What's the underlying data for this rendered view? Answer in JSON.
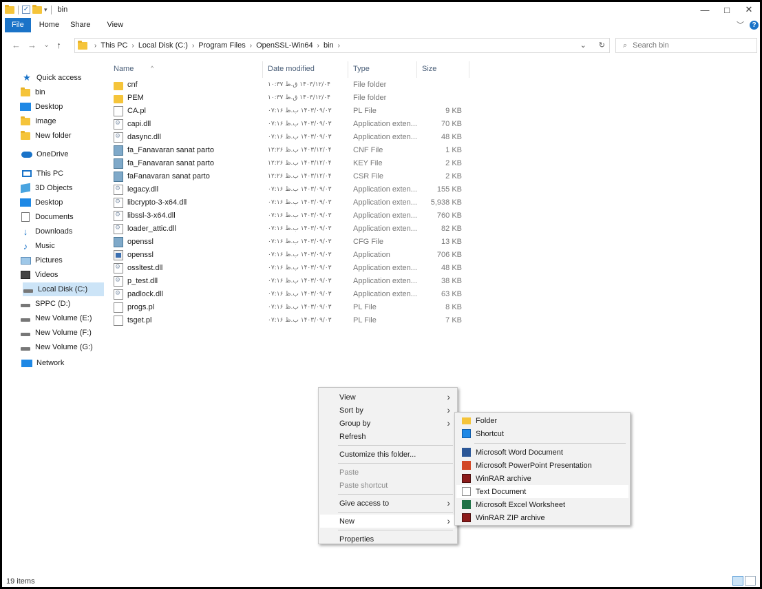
{
  "window": {
    "title": "bin",
    "minimize": "—",
    "maximize": "□",
    "close": "✕"
  },
  "ribbon": {
    "tabs": [
      "File",
      "Home",
      "Share",
      "View"
    ],
    "expand_icon": "﹀",
    "help_icon": "?"
  },
  "nav_glyphs": {
    "back": "←",
    "forward": "→",
    "recent": "⌄",
    "up": "↑",
    "dropdown": "⌄",
    "refresh": "↻",
    "search": "⌕"
  },
  "address": {
    "crumbs": [
      "This PC",
      "Local Disk (C:)",
      "Program Files",
      "OpenSSL-Win64",
      "bin"
    ],
    "separator": "›"
  },
  "search": {
    "placeholder": "Search bin"
  },
  "sidebar": {
    "quick_access": "Quick access",
    "quick_items": [
      "bin",
      "Desktop",
      "Image",
      "New folder"
    ],
    "onedrive": "OneDrive",
    "this_pc": "This PC",
    "pc_items": [
      "3D Objects",
      "Desktop",
      "Documents",
      "Downloads",
      "Music",
      "Pictures",
      "Videos",
      "Local Disk (C:)",
      "SPPC (D:)",
      "New Volume (E:)",
      "New Volume (F:)",
      "New Volume (G:)"
    ],
    "network": "Network"
  },
  "columns": {
    "name": "Name",
    "date": "Date modified",
    "type": "Type",
    "size": "Size",
    "sort_caret": "^"
  },
  "files": [
    {
      "name": "cnf",
      "date": "۱۴۰۳/۱۲/۰۴ ق.ظ ۱۰:۳۷",
      "type": "File folder",
      "size": "",
      "icon": "folder"
    },
    {
      "name": "PEM",
      "date": "۱۴۰۳/۱۲/۰۴ ق.ظ ۱۰:۳۷",
      "type": "File folder",
      "size": "",
      "icon": "folder"
    },
    {
      "name": "CA.pl",
      "date": "۱۴۰۳/۰۹/۰۳ ب.ظ ۰۷:۱۶",
      "type": "PL File",
      "size": "9 KB",
      "icon": "file"
    },
    {
      "name": "capi.dll",
      "date": "۱۴۰۳/۰۹/۰۳ ب.ظ ۰۷:۱۶",
      "type": "Application exten...",
      "size": "70 KB",
      "icon": "dll"
    },
    {
      "name": "dasync.dll",
      "date": "۱۴۰۳/۰۹/۰۳ ب.ظ ۰۷:۱۶",
      "type": "Application exten...",
      "size": "48 KB",
      "icon": "dll"
    },
    {
      "name": "fa_Fanavaran sanat parto",
      "date": "۱۴۰۳/۱۲/۰۴ ب.ظ ۱۲:۲۶",
      "type": "CNF File",
      "size": "1 KB",
      "icon": "cert"
    },
    {
      "name": "fa_Fanavaran sanat parto",
      "date": "۱۴۰۳/۱۲/۰۴ ب.ظ ۱۲:۲۶",
      "type": "KEY File",
      "size": "2 KB",
      "icon": "cert"
    },
    {
      "name": "faFanavaran sanat parto",
      "date": "۱۴۰۳/۱۲/۰۴ ب.ظ ۱۲:۲۶",
      "type": "CSR File",
      "size": "2 KB",
      "icon": "cert"
    },
    {
      "name": "legacy.dll",
      "date": "۱۴۰۳/۰۹/۰۳ ب.ظ ۰۷:۱۶",
      "type": "Application exten...",
      "size": "155 KB",
      "icon": "dll"
    },
    {
      "name": "libcrypto-3-x64.dll",
      "date": "۱۴۰۳/۰۹/۰۳ ب.ظ ۰۷:۱۶",
      "type": "Application exten...",
      "size": "5,938 KB",
      "icon": "dll"
    },
    {
      "name": "libssl-3-x64.dll",
      "date": "۱۴۰۳/۰۹/۰۳ ب.ظ ۰۷:۱۶",
      "type": "Application exten...",
      "size": "760 KB",
      "icon": "dll"
    },
    {
      "name": "loader_attic.dll",
      "date": "۱۴۰۳/۰۹/۰۳ ب.ظ ۰۷:۱۶",
      "type": "Application exten...",
      "size": "82 KB",
      "icon": "dll"
    },
    {
      "name": "openssl",
      "date": "۱۴۰۳/۰۹/۰۳ ب.ظ ۰۷:۱۶",
      "type": "CFG File",
      "size": "13 KB",
      "icon": "cfg"
    },
    {
      "name": "openssl",
      "date": "۱۴۰۳/۰۹/۰۳ ب.ظ ۰۷:۱۶",
      "type": "Application",
      "size": "706 KB",
      "icon": "app"
    },
    {
      "name": "ossltest.dll",
      "date": "۱۴۰۳/۰۹/۰۳ ب.ظ ۰۷:۱۶",
      "type": "Application exten...",
      "size": "48 KB",
      "icon": "dll"
    },
    {
      "name": "p_test.dll",
      "date": "۱۴۰۳/۰۹/۰۳ ب.ظ ۰۷:۱۶",
      "type": "Application exten...",
      "size": "38 KB",
      "icon": "dll"
    },
    {
      "name": "padlock.dll",
      "date": "۱۴۰۳/۰۹/۰۳ ب.ظ ۰۷:۱۶",
      "type": "Application exten...",
      "size": "63 KB",
      "icon": "dll"
    },
    {
      "name": "progs.pl",
      "date": "۱۴۰۳/۰۹/۰۳ ب.ظ ۰۷:۱۶",
      "type": "PL File",
      "size": "8 KB",
      "icon": "file"
    },
    {
      "name": "tsget.pl",
      "date": "۱۴۰۳/۰۹/۰۳ ب.ظ ۰۷:۱۶",
      "type": "PL File",
      "size": "7 KB",
      "icon": "file"
    }
  ],
  "context_menu": {
    "submenu_arrow": "›",
    "items": [
      {
        "label": "View",
        "submenu": true,
        "disabled": false
      },
      {
        "label": "Sort by",
        "submenu": true,
        "disabled": false
      },
      {
        "label": "Group by",
        "submenu": true,
        "disabled": false
      },
      {
        "label": "Refresh",
        "submenu": false,
        "disabled": false
      },
      {
        "sep": true
      },
      {
        "label": "Customize this folder...",
        "submenu": false,
        "disabled": false
      },
      {
        "sep": true
      },
      {
        "label": "Paste",
        "submenu": false,
        "disabled": true
      },
      {
        "label": "Paste shortcut",
        "submenu": false,
        "disabled": true
      },
      {
        "sep": true
      },
      {
        "label": "Give access to",
        "submenu": true,
        "disabled": false
      },
      {
        "sep": true
      },
      {
        "label": "New",
        "submenu": true,
        "disabled": false,
        "highlighted": true
      },
      {
        "sep": true
      },
      {
        "label": "Properties",
        "submenu": false,
        "disabled": false
      }
    ]
  },
  "new_submenu": {
    "items": [
      {
        "label": "Folder",
        "icon": "folder"
      },
      {
        "label": "Shortcut",
        "icon": "shortcut"
      },
      {
        "sep": true
      },
      {
        "label": "Microsoft Word Document",
        "icon": "word"
      },
      {
        "label": "Microsoft PowerPoint Presentation",
        "icon": "powerpoint"
      },
      {
        "label": "WinRAR archive",
        "icon": "winrar"
      },
      {
        "label": "Text Document",
        "icon": "text",
        "highlighted": true
      },
      {
        "label": "Microsoft Excel Worksheet",
        "icon": "excel"
      },
      {
        "label": "WinRAR ZIP archive",
        "icon": "winrar"
      }
    ]
  },
  "status": {
    "count": "19 items"
  }
}
